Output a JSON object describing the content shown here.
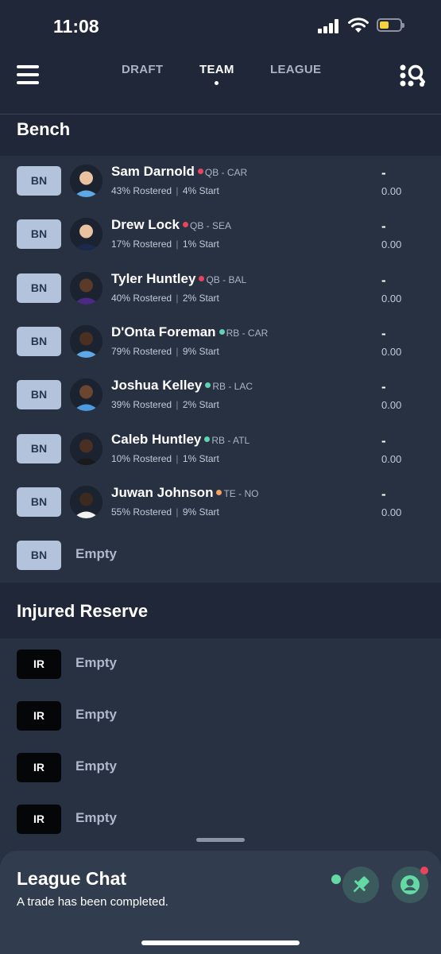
{
  "status": {
    "time": "11:08"
  },
  "nav": {
    "tabs": [
      "DRAFT",
      "TEAM",
      "LEAGUE"
    ],
    "active_tab": "TEAM"
  },
  "sections": {
    "bench_title": "Bench",
    "ir_title": "Injured Reserve"
  },
  "bench": [
    {
      "slot": "BN",
      "name": "Sam Darnold",
      "pos": "QB - CAR",
      "status_color": "#e8445d",
      "rostered": "43% Rostered",
      "start": "4% Start",
      "proj": "-",
      "points": "0.00",
      "jersey": "#5fa8e6",
      "skin": "#e9c3a1"
    },
    {
      "slot": "BN",
      "name": "Drew Lock",
      "pos": "QB - SEA",
      "status_color": "#e8445d",
      "rostered": "17% Rostered",
      "start": "1% Start",
      "proj": "-",
      "points": "0.00",
      "jersey": "#1b2a4a",
      "skin": "#e9c3a1"
    },
    {
      "slot": "BN",
      "name": "Tyler Huntley",
      "pos": "QB - BAL",
      "status_color": "#e8445d",
      "rostered": "40% Rostered",
      "start": "2% Start",
      "proj": "-",
      "points": "0.00",
      "jersey": "#4b2a86",
      "skin": "#5a3a28"
    },
    {
      "slot": "BN",
      "name": "D'Onta Foreman",
      "pos": "RB - CAR",
      "status_color": "#5fd3b3",
      "rostered": "79% Rostered",
      "start": "9% Start",
      "proj": "-",
      "points": "0.00",
      "jersey": "#5fa8e6",
      "skin": "#4a3022"
    },
    {
      "slot": "BN",
      "name": "Joshua Kelley",
      "pos": "RB - LAC",
      "status_color": "#5fd3b3",
      "rostered": "39% Rostered",
      "start": "2% Start",
      "proj": "-",
      "points": "0.00",
      "jersey": "#4c9be0",
      "skin": "#6a4530"
    },
    {
      "slot": "BN",
      "name": "Caleb Huntley",
      "pos": "RB - ATL",
      "status_color": "#5fd3b3",
      "rostered": "10% Rostered",
      "start": "1% Start",
      "proj": "-",
      "points": "0.00",
      "jersey": "#1a1a1a",
      "skin": "#4a3022"
    },
    {
      "slot": "BN",
      "name": "Juwan Johnson",
      "pos": "TE - NO",
      "status_color": "#f4a261",
      "rostered": "55% Rostered",
      "start": "9% Start",
      "proj": "-",
      "points": "0.00",
      "jersey": "#f2f2f2",
      "skin": "#3d2a1f"
    }
  ],
  "bench_empty": {
    "slot": "BN",
    "label": "Empty"
  },
  "ir": [
    {
      "slot": "IR",
      "label": "Empty"
    },
    {
      "slot": "IR",
      "label": "Empty"
    },
    {
      "slot": "IR",
      "label": "Empty"
    },
    {
      "slot": "IR",
      "label": "Empty"
    }
  ],
  "chat": {
    "title": "League Chat",
    "message": "A trade has been completed."
  },
  "colors": {
    "background": "#283142",
    "header": "#1f2738",
    "bn_badge": "#b3c3dc",
    "ir_badge": "#050608",
    "chat_panel": "#313c4f"
  }
}
